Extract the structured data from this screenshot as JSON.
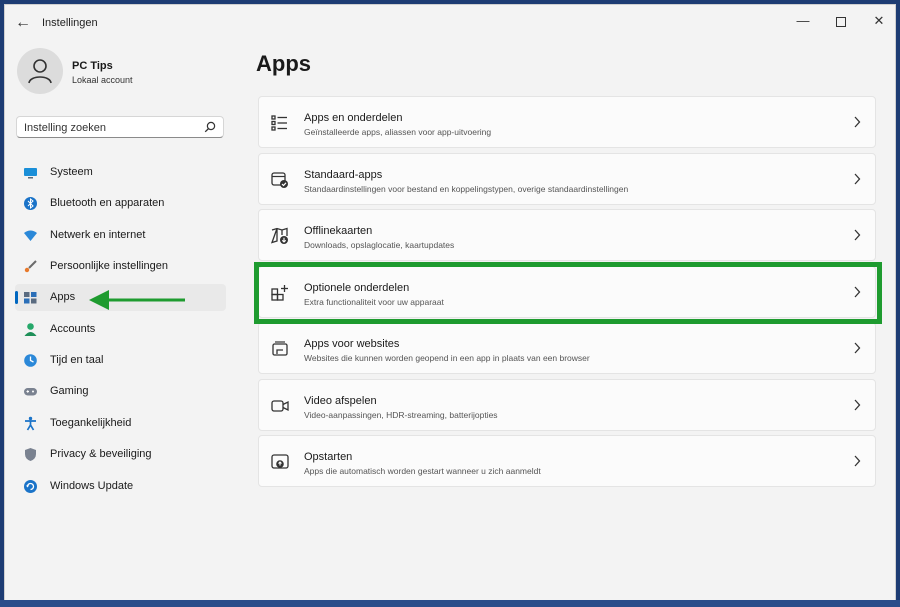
{
  "window": {
    "title": "Instellingen"
  },
  "profile": {
    "name": "PC Tips",
    "subtitle": "Lokaal account"
  },
  "search": {
    "placeholder": "Instelling zoeken"
  },
  "nav": [
    {
      "label": "Systeem",
      "icon": "monitor-icon"
    },
    {
      "label": "Bluetooth en apparaten",
      "icon": "bluetooth-icon"
    },
    {
      "label": "Netwerk en internet",
      "icon": "wifi-icon"
    },
    {
      "label": "Persoonlijke instellingen",
      "icon": "brush-icon"
    },
    {
      "label": "Apps",
      "icon": "apps-icon",
      "selected": true
    },
    {
      "label": "Accounts",
      "icon": "person-icon"
    },
    {
      "label": "Tijd en taal",
      "icon": "globe-clock-icon"
    },
    {
      "label": "Gaming",
      "icon": "gamepad-icon"
    },
    {
      "label": "Toegankelijkheid",
      "icon": "accessibility-icon"
    },
    {
      "label": "Privacy & beveiliging",
      "icon": "shield-icon"
    },
    {
      "label": "Windows Update",
      "icon": "update-icon"
    }
  ],
  "page": {
    "title": "Apps"
  },
  "cards": [
    {
      "title": "Apps en onderdelen",
      "subtitle": "Geïnstalleerde apps, aliassen voor app-uitvoering",
      "icon": "list-icon"
    },
    {
      "title": "Standaard-apps",
      "subtitle": "Standaardinstellingen voor bestand en koppelingstypen, overige standaardinstellingen",
      "icon": "default-apps-icon"
    },
    {
      "title": "Offlinekaarten",
      "subtitle": "Downloads, opslaglocatie, kaartupdates",
      "icon": "map-download-icon"
    },
    {
      "title": "Optionele onderdelen",
      "subtitle": "Extra functionaliteit voor uw apparaat",
      "icon": "grid-add-icon"
    },
    {
      "title": "Apps voor websites",
      "subtitle": "Websites die kunnen worden geopend in een app in plaats van een browser",
      "icon": "web-app-icon"
    },
    {
      "title": "Video afspelen",
      "subtitle": "Video-aanpassingen, HDR-streaming, batterijopties",
      "icon": "video-icon"
    },
    {
      "title": "Opstarten",
      "subtitle": "Apps die automatisch worden gestart wanneer u zich aanmeldt",
      "icon": "startup-icon"
    }
  ],
  "colors": {
    "accent": "#0067c0",
    "highlight": "#1e9b2f",
    "background": "#f3f3f3"
  }
}
